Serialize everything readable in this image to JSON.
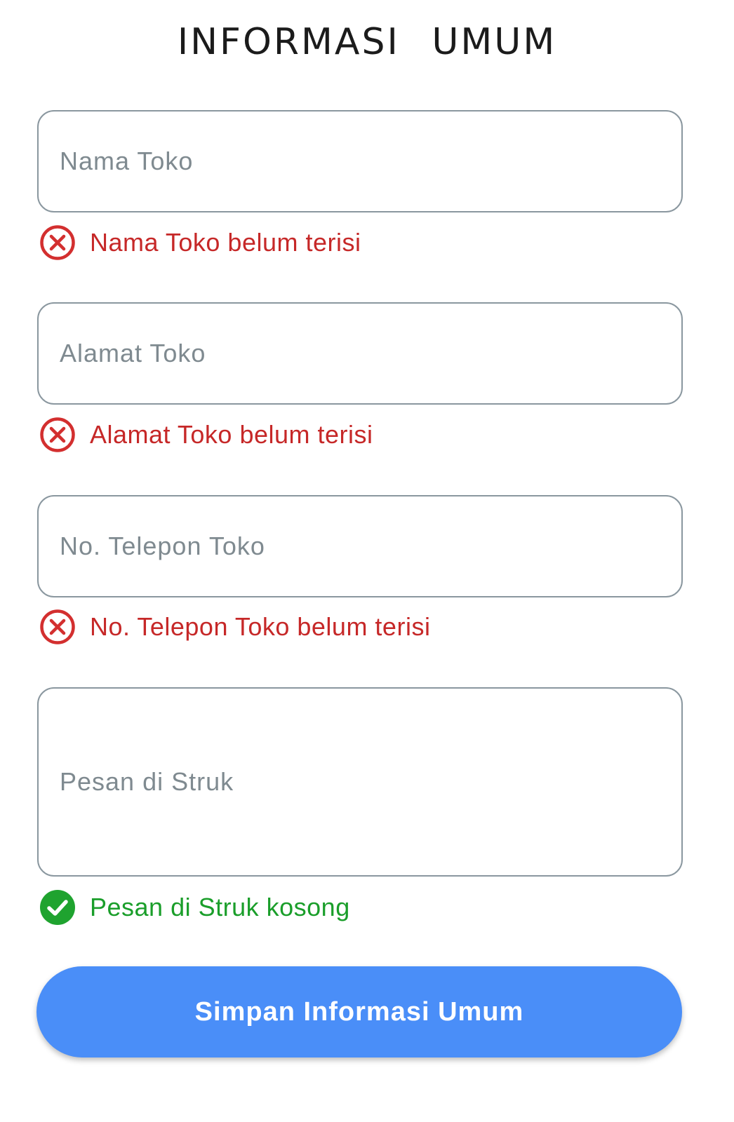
{
  "page": {
    "title": "INFORMASI UMUM"
  },
  "form": {
    "fields": [
      {
        "placeholder": "Nama Toko",
        "value": "",
        "status": "error",
        "message": "Nama Toko belum terisi"
      },
      {
        "placeholder": "Alamat Toko",
        "value": "",
        "status": "error",
        "message": "Alamat Toko belum terisi"
      },
      {
        "placeholder": "No. Telepon Toko",
        "value": "",
        "status": "error",
        "message": "No. Telepon Toko belum terisi"
      },
      {
        "placeholder": "Pesan di Struk",
        "value": "",
        "status": "ok",
        "message": "Pesan di Struk kosong"
      }
    ],
    "submit_label": "Simpan Informasi Umum"
  },
  "icons": {
    "error": "error-circle-x-icon",
    "ok": "check-circle-icon"
  },
  "colors": {
    "error": "#c62828",
    "ok": "#1a9e2a",
    "primary_button": "#4a8ef8",
    "field_border": "#8a979f"
  }
}
